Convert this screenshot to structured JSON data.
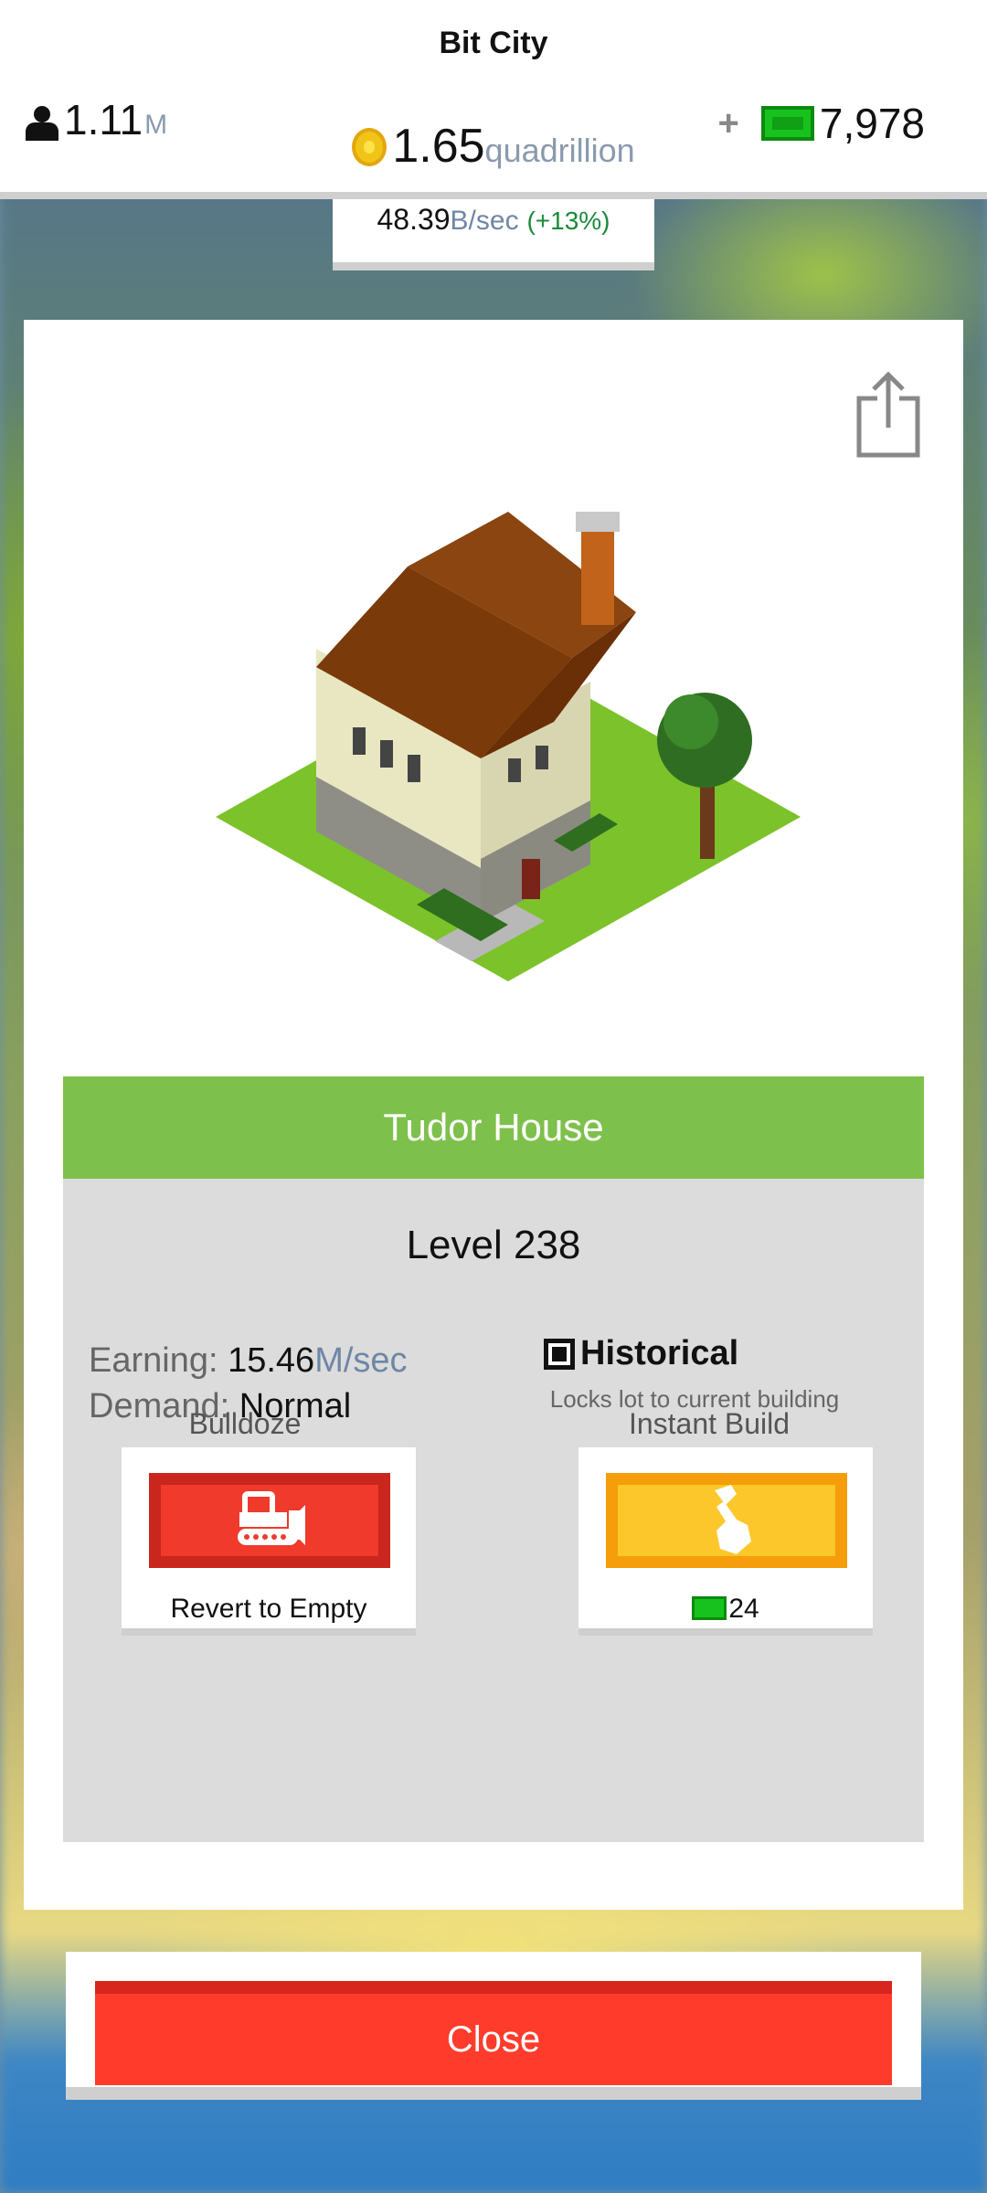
{
  "app": {
    "title": "Bit City"
  },
  "stats": {
    "population_value": "1.11",
    "population_unit": "M",
    "money_value": "1.65",
    "money_unit": "quadrillion",
    "rate_value": "48.39",
    "rate_unit": "B/sec",
    "rate_bonus": "(+13%)",
    "cash_plus": "+",
    "cash_value": "7,978"
  },
  "building": {
    "name": "Tudor House",
    "level": "Level 238",
    "earning_label": "Earning: ",
    "earning_value": "15.46",
    "earning_unit": "M/sec",
    "demand_label": "Demand: ",
    "demand_value": "Normal",
    "historical_label": "Historical",
    "historical_checked": true,
    "historical_desc": "Locks lot to current building"
  },
  "actions": {
    "bulldoze_title": "Bulldoze",
    "bulldoze_caption": "Revert to Empty",
    "instant_title": "Instant Build",
    "instant_cost": "24"
  },
  "close_label": "Close",
  "icons": [
    "person-icon",
    "coin-icon",
    "cash-icon",
    "share-icon",
    "bulldozer-icon",
    "hammer-icon",
    "checkbox-icon"
  ],
  "colors": {
    "title_bar": "#7ec04c",
    "bulldoze": "#ef3a2c",
    "instant": "#fcc72a",
    "close": "#ff3b2c",
    "cash": "#18c21e"
  }
}
